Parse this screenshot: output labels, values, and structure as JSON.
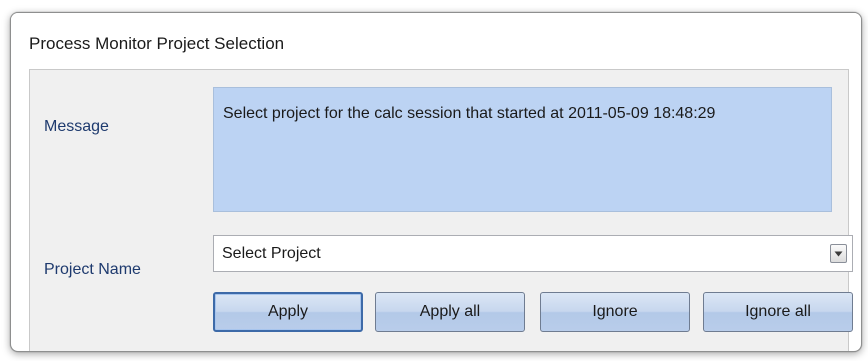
{
  "window": {
    "title": "Process Monitor Project Selection"
  },
  "message": {
    "label": "Message",
    "text": "Select project for the calc session that started at 2011-05-09 18:48:29"
  },
  "project": {
    "label": "Project Name",
    "selected": "Select Project",
    "dropdown_icon": "chevron-down-icon"
  },
  "buttons": {
    "apply": "Apply",
    "apply_all": "Apply all",
    "ignore": "Ignore",
    "ignore_all": "Ignore all"
  },
  "colors": {
    "message_background": "#bcd3f3",
    "label_text": "#1e3a6e",
    "dialog_background": "#f0f0f0"
  }
}
